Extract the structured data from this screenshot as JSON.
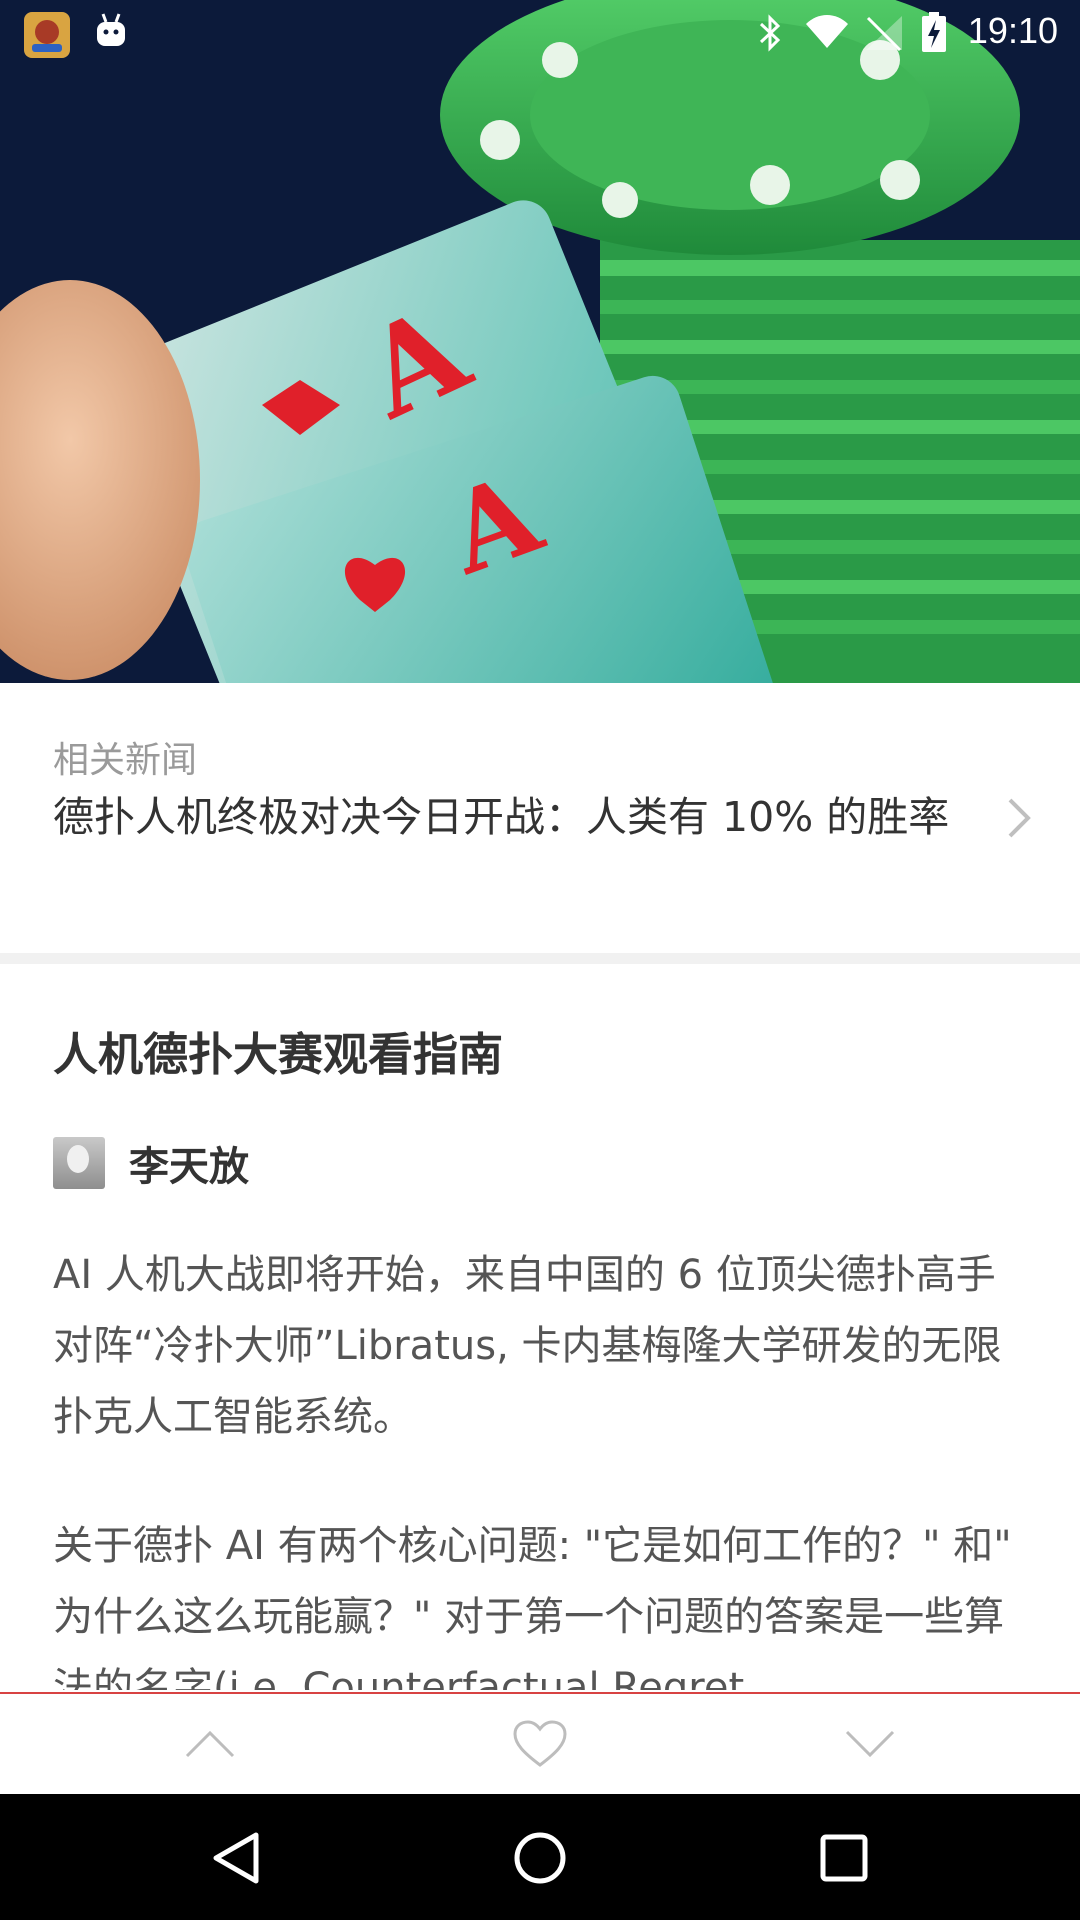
{
  "status_bar": {
    "time": "19:10",
    "icons": [
      "game-app-icon",
      "android-robot-icon",
      "bluetooth-icon",
      "wifi-icon",
      "signal-icon",
      "battery-charging-icon"
    ]
  },
  "hero": {
    "icon": "poker-aces-image"
  },
  "related_news": {
    "label": "相关新闻",
    "title": "德扑人机终极对决今日开战：人类有 10% 的胜率",
    "chevron_icon": "chevron-right-icon"
  },
  "article": {
    "title": "人机德扑大赛观看指南",
    "author": "李天放",
    "paragraphs": [
      "AI 人机大战即将开始，来自中国的 6 位顶尖德扑高手对阵“冷扑大师”Libratus, 卡内基梅隆大学研发的无限扑克人工智能系统。",
      "关于德扑 AI 有两个核心问题: \"它是如何工作的？\" 和\" 为什么这么玩能赢？\" 对于第一个问题的答案是一些算法的名字(i.e. Counterfactual Regret"
    ]
  },
  "action_bar": {
    "buttons": [
      "chevron-up-icon",
      "heart-icon",
      "chevron-down-icon"
    ],
    "accent": "#d84343"
  },
  "nav_bar": {
    "buttons": [
      "back-icon",
      "home-icon",
      "recents-icon"
    ]
  }
}
